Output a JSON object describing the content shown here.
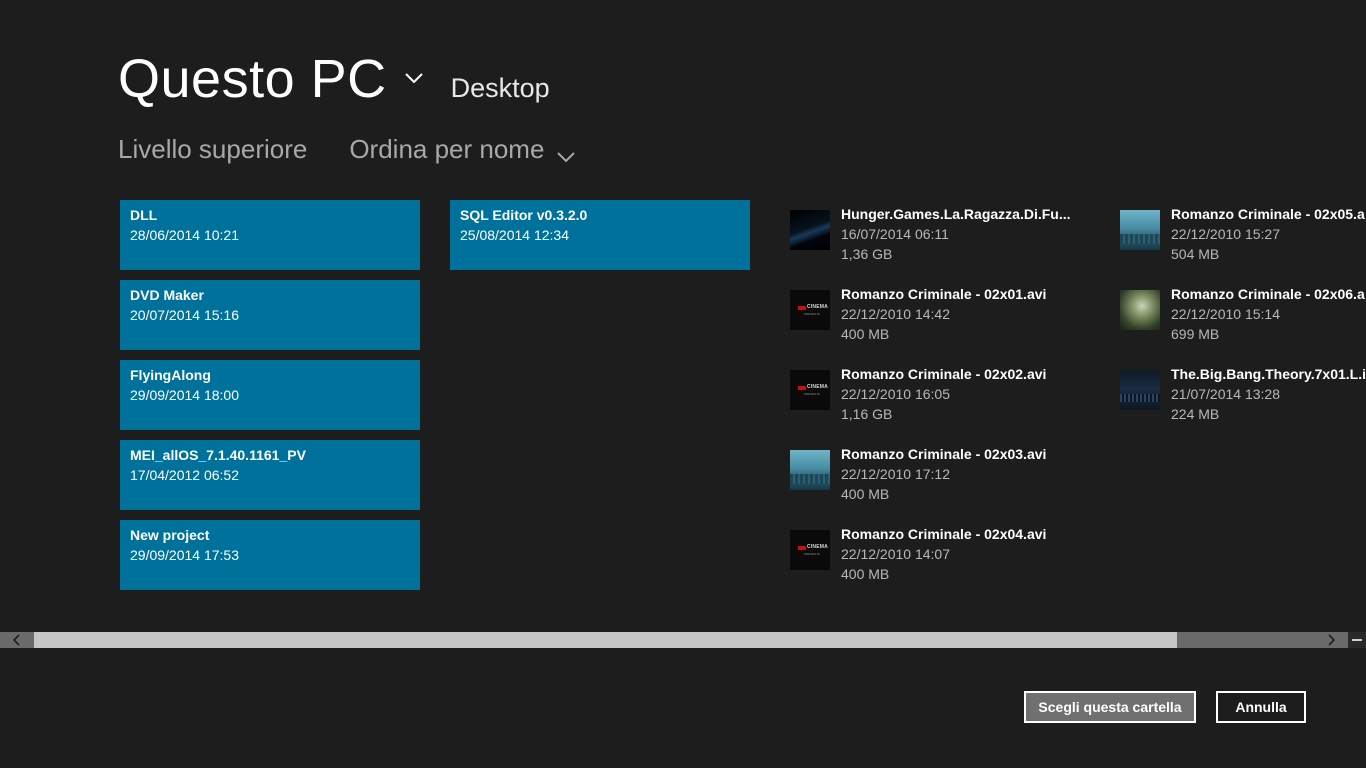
{
  "header": {
    "location": "Questo PC",
    "subfolder": "Desktop"
  },
  "commands": {
    "up_level": "Livello superiore",
    "sort": "Ordina per nome"
  },
  "folders": [
    {
      "name": "DLL",
      "date": "28/06/2014 10:21"
    },
    {
      "name": "DVD Maker",
      "date": "20/07/2014 15:16"
    },
    {
      "name": "FlyingAlong",
      "date": "29/09/2014 18:00"
    },
    {
      "name": "MEI_allOS_7.1.40.1161_PV",
      "date": "17/04/2012 06:52"
    },
    {
      "name": "New project",
      "date": "29/09/2014 17:53"
    },
    {
      "name": "SQL Editor v0.3.2.0",
      "date": "25/08/2014 12:34"
    }
  ],
  "files": [
    {
      "name": "Hunger.Games.La.Ragazza.Di.Fu...",
      "date": "16/07/2014 06:11",
      "size": "1,36 GB",
      "thumb": "dark-streak-thumbnail"
    },
    {
      "name": "Romanzo Criminale - 02x01.avi",
      "date": "22/12/2010 14:42",
      "size": "400 MB",
      "thumb": "cinema-title-thumbnail"
    },
    {
      "name": "Romanzo Criminale - 02x02.avi",
      "date": "22/12/2010 16:05",
      "size": "1,16 GB",
      "thumb": "cinema-title-thumbnail"
    },
    {
      "name": "Romanzo Criminale - 02x03.avi",
      "date": "22/12/2010 17:12",
      "size": "400 MB",
      "thumb": "city-skyline-thumbnail"
    },
    {
      "name": "Romanzo Criminale - 02x04.avi",
      "date": "22/12/2010 14:07",
      "size": "400 MB",
      "thumb": "cinema-title-thumbnail"
    },
    {
      "name": "Romanzo Criminale - 02x05.a",
      "date": "22/12/2010 15:27",
      "size": "504 MB",
      "thumb": "city-skyline-thumbnail"
    },
    {
      "name": "Romanzo Criminale - 02x06.a",
      "date": "22/12/2010 15:14",
      "size": "699 MB",
      "thumb": "portrait-thumbnail"
    },
    {
      "name": "The.Big.Bang.Theory.7x01.L.i",
      "date": "21/07/2014 13:28",
      "size": "224 MB",
      "thumb": "night-city-thumbnail"
    }
  ],
  "thumbnail_text": {
    "cinema_word": "CINEMA",
    "cinema_sub": "PRESENTA"
  },
  "buttons": {
    "choose": "Scegli questa cartella",
    "cancel": "Annulla"
  },
  "colors": {
    "background": "#1d1d1d",
    "tile": "#00719b",
    "scrollbar_track": "#6a6a6a",
    "scrollbar_thumb": "#c6c6c6"
  }
}
